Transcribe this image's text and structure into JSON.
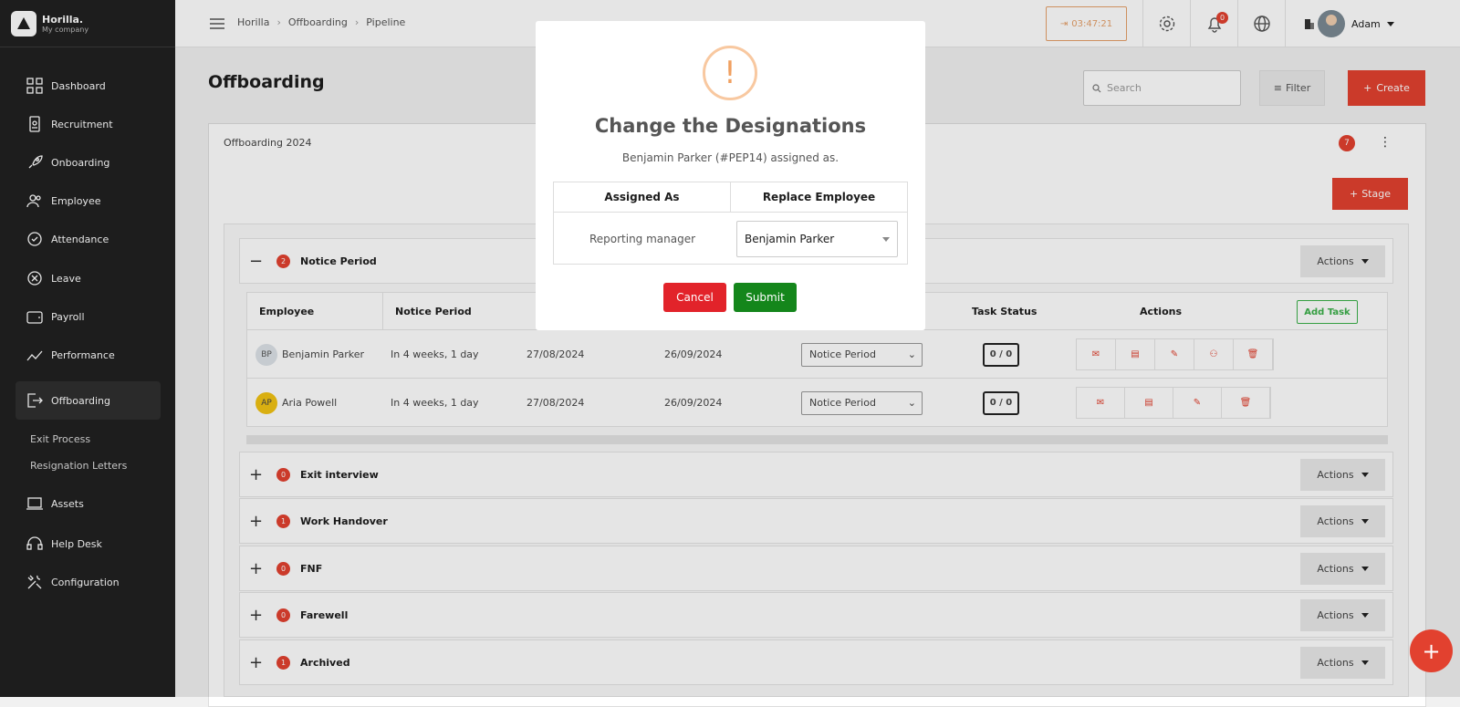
{
  "brand": {
    "name": "Horilla.",
    "company": "My company"
  },
  "sidebar": {
    "items": [
      {
        "label": "Dashboard",
        "icon": "dashboard-icon"
      },
      {
        "label": "Recruitment",
        "icon": "recruitment-icon"
      },
      {
        "label": "Onboarding",
        "icon": "rocket-icon"
      },
      {
        "label": "Employee",
        "icon": "people-icon"
      },
      {
        "label": "Attendance",
        "icon": "check-circle-icon"
      },
      {
        "label": "Leave",
        "icon": "close-circle-icon"
      },
      {
        "label": "Payroll",
        "icon": "wallet-icon"
      },
      {
        "label": "Performance",
        "icon": "chart-line-icon"
      },
      {
        "label": "Offboarding",
        "icon": "exit-icon"
      },
      {
        "label": "Assets",
        "icon": "laptop-icon"
      },
      {
        "label": "Help Desk",
        "icon": "headset-icon"
      },
      {
        "label": "Configuration",
        "icon": "tools-icon"
      }
    ],
    "submenu": [
      "Exit Process",
      "Resignation Letters"
    ]
  },
  "topbar": {
    "breadcrumb": [
      "Horilla",
      "Offboarding",
      "Pipeline"
    ],
    "timer": "03:47:21",
    "notifications": "0",
    "user": "Adam"
  },
  "page": {
    "title": "Offboarding",
    "search_placeholder": "Search",
    "filter_label": "Filter",
    "create_label": "Create",
    "panel_title": "Offboarding 2024",
    "panel_count": "7",
    "stage_button": "Stage",
    "actions_label": "Actions"
  },
  "stages": [
    {
      "name": "Notice Period",
      "count": "2",
      "expanded": true
    },
    {
      "name": "Exit interview",
      "count": "0"
    },
    {
      "name": "Work Handover",
      "count": "1"
    },
    {
      "name": "FNF",
      "count": "0"
    },
    {
      "name": "Farewell",
      "count": "0"
    },
    {
      "name": "Archived",
      "count": "1"
    }
  ],
  "table": {
    "headers": [
      "Employee",
      "Notice Period",
      "Task Status",
      "Actions"
    ],
    "add_task": "Add Task",
    "rows": [
      {
        "initials": "BP",
        "name": "Benjamin Parker",
        "notice": "In 4 weeks, 1 day",
        "start": "27/08/2024",
        "end": "26/09/2024",
        "stage": "Notice Period",
        "tasks": "0 / 0"
      },
      {
        "initials": "AP",
        "name": "Aria Powell",
        "notice": "In 4 weeks, 1 day",
        "start": "27/08/2024",
        "end": "26/09/2024",
        "stage": "Notice Period",
        "tasks": "0 / 0"
      }
    ]
  },
  "modal": {
    "title": "Change the Designations",
    "subtitle": "Benjamin Parker (#PEP14) assigned as.",
    "col_assigned": "Assigned As",
    "col_replace": "Replace Employee",
    "role": "Reporting manager",
    "selected_employee": "Benjamin Parker",
    "cancel": "Cancel",
    "submit": "Submit"
  },
  "colors": {
    "accent": "#e2412f",
    "sidebar": "#212121",
    "success": "#14861b",
    "danger": "#e2232a",
    "warning": "#f0a060"
  }
}
